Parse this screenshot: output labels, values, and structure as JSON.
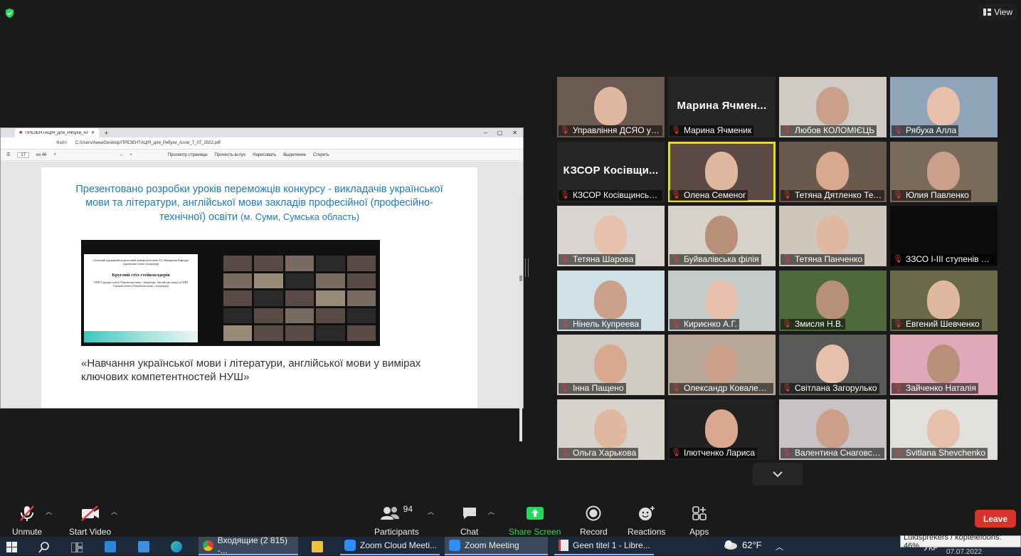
{
  "topbar": {
    "view_label": "View"
  },
  "shared_screen": {
    "browser_tab": "ПРЕЗЕНТАЦІЯ_для_Рябухи_Алл",
    "file_label": "Файл",
    "path": "C:/Users/Анна/Desktop/ПРЕЗЕНТАЦІЯ_для_Рябухи_Алли_7_07_2022.pdf",
    "page_current": "17",
    "page_total": "из 46",
    "toolbar": [
      "Просмотр страницы",
      "Прочесть вслух",
      "Нарисовать",
      "Выделение",
      "Стереть"
    ],
    "slide_heading_main": "Презентовано розробки уроків переможців конкурсу - викладачів української мови та літератури, англійської мови закладів професійної (професійно-технічної) освіти",
    "slide_heading_small": "(м. Суми, Сумська область)",
    "inner_slide_org": "Сумський державний педагогічний університет імені А.С.Макаренка Кафедра української мови і літератури",
    "inner_slide_title": "Круглий стіл стейкхолдерів",
    "inner_slide_text": "ОПП Середня освіта (Українська мова і література. Англійська мова) та ОПП Середня освіта (Англійська мова і література)",
    "slide_caption": "«Навчання української мови і літератури, англійської мови у вимірах ключових компетентностей НУШ»"
  },
  "participants": [
    {
      "name": "Управління ДСЯО у С...",
      "big": "",
      "bg": "#6b5a52"
    },
    {
      "name": "Марина  Ячменик",
      "big": "Марина  Ячмен...",
      "bg": "#262626"
    },
    {
      "name": "Любов КОЛОМІЄЦЬ",
      "big": "",
      "bg": "#cfcac4"
    },
    {
      "name": "Рябуха Алла",
      "big": "",
      "bg": "#8fa4b8"
    },
    {
      "name": "КЗСОР Косівщинська ...",
      "big": "КЗСОР  Косівщи...",
      "bg": "#262626"
    },
    {
      "name": "Олена Семеног",
      "big": "",
      "bg": "#5c4a44",
      "active": true
    },
    {
      "name": "Тетяна Дятленко Тетя...",
      "big": "",
      "bg": "#6a5a4e"
    },
    {
      "name": "Юлия Павленко",
      "big": "",
      "bg": "#7a6a5a"
    },
    {
      "name": "Тетяна Шарова",
      "big": "",
      "bg": "#d8d4cf"
    },
    {
      "name": "Буйвалівська філія",
      "big": "",
      "bg": "#d6d2c8"
    },
    {
      "name": "Тетяна Панченко",
      "big": "",
      "bg": "#cfc6bc"
    },
    {
      "name": "ЗЗСО І-ІІІ ступенів 2 Т...",
      "big": "",
      "bg": "#0c0c0c"
    },
    {
      "name": "Нінель Купреева",
      "big": "",
      "bg": "#cfe0e6"
    },
    {
      "name": "Кириєнко А.Г.",
      "big": "",
      "bg": "#c4cbc8"
    },
    {
      "name": "Змисля Н.В.",
      "big": "",
      "bg": "#4f6a3a"
    },
    {
      "name": "Евгений Шевченко",
      "big": "",
      "bg": "#6a6a4a"
    },
    {
      "name": "Інна Пащено",
      "big": "",
      "bg": "#d0ccc4"
    },
    {
      "name": "Олександр Коваленко",
      "big": "",
      "bg": "#b8a898"
    },
    {
      "name": "Світлана Загорулько",
      "big": "",
      "bg": "#5a5a58"
    },
    {
      "name": "Зайченко Наталія",
      "big": "",
      "bg": "#e0a8b8"
    },
    {
      "name": "Ольга Харькова",
      "big": "",
      "bg": "#d6d2cc"
    },
    {
      "name": "Ілютченко Лариса",
      "big": "",
      "bg": "#222222"
    },
    {
      "name": "Валентина Снаговська",
      "big": "",
      "bg": "#c8c2c4"
    },
    {
      "name": "Svitlana Shevchenko",
      "big": "",
      "bg": "#e2e0dc"
    }
  ],
  "toolbar": {
    "unmute": "Unmute",
    "start_video": "Start Video",
    "participants": "Participants",
    "participants_count": "94",
    "chat": "Chat",
    "share_screen": "Share Screen",
    "record": "Record",
    "reactions": "Reactions",
    "apps": "Apps",
    "leave": "Leave"
  },
  "taskbar": {
    "chrome": "Входящие (2 815) -...",
    "zoom_cloud": "Zoom Cloud Meeti...",
    "zoom_meeting": "Zoom Meeting",
    "libre": "Geen titel 1 - Libre...",
    "weather": "62°F",
    "lang": "УКР",
    "date": "07.07.2022",
    "tooltip": "Luidsprekers / koptelefoons: 46%"
  },
  "colors": {
    "accent_green": "#23d959",
    "leave_red": "#d9322b",
    "active_outline": "#e5e500",
    "muted_red": "#e23b3b"
  }
}
